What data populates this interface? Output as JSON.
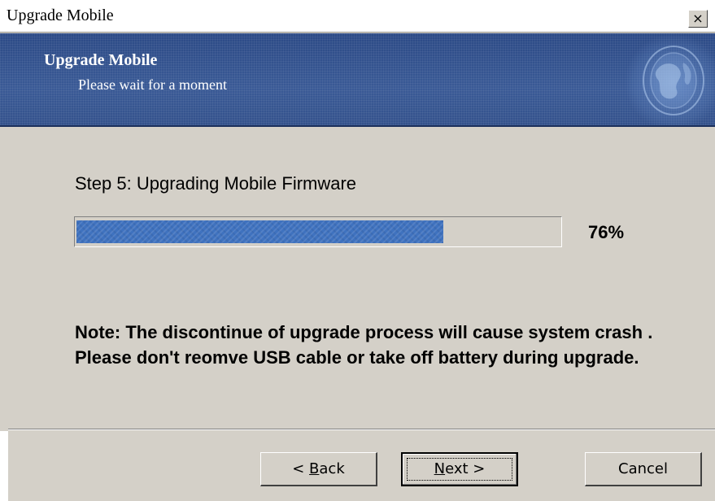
{
  "window": {
    "title": "Upgrade Mobile",
    "close_glyph": "×",
    "close_icon": "close-icon"
  },
  "banner": {
    "title": "Upgrade Mobile",
    "subtitle": "Please wait for a moment",
    "logo_icon": "globe-logo-icon",
    "colors": {
      "background": "#2f4c86",
      "text": "#ffffff"
    }
  },
  "content": {
    "step_label": "Step 5: Upgrading Mobile Firmware",
    "progress": {
      "percent": 76,
      "percent_text": "76%",
      "fill_color": "#3f72bf"
    },
    "note": "Note: The discontinue of upgrade process will cause system crash . Please don't reomve USB cable or take off battery during upgrade."
  },
  "buttons": {
    "back": {
      "prefix": "< ",
      "mnemonic": "B",
      "rest": "ack"
    },
    "next": {
      "mnemonic": "N",
      "rest": "ext >"
    },
    "cancel": {
      "label": "Cancel"
    }
  }
}
